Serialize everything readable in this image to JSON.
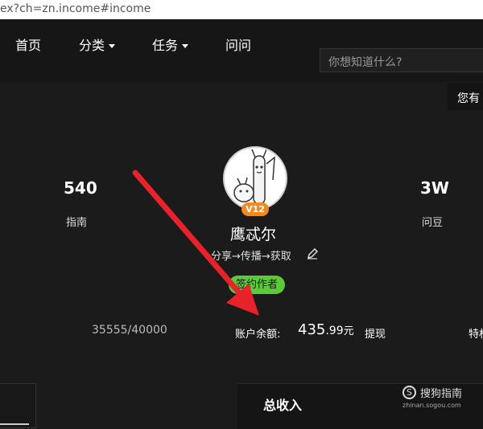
{
  "browser": {
    "url_fragment": "ex?ch=zn.income#income"
  },
  "nav": {
    "items": [
      {
        "label": "首页"
      },
      {
        "label": "分类"
      },
      {
        "label": "任务"
      },
      {
        "label": "问问"
      }
    ],
    "search_placeholder": "你想知道什么?",
    "notice_text": "您有"
  },
  "profile": {
    "stats_left": {
      "value": "540",
      "label": "指南"
    },
    "stats_right": {
      "value": "3W",
      "label": "问豆"
    },
    "level": "V12",
    "username": "鹰忒尔",
    "tagline": "分享→传播→获取",
    "author_badge": "签约作者",
    "progress": "35555/40000",
    "balance": {
      "label": "账户余额:",
      "integer": "435",
      "decimal": ".99",
      "unit": "元"
    },
    "withdraw_label": "提现",
    "right_truncated": "特权"
  },
  "bottom": {
    "total_income_label": "总收入"
  },
  "watermark": {
    "glyph": "S",
    "name": "搜狗指南",
    "url": "zhinan.sogou.com"
  },
  "colors": {
    "background": "#1b1b1b",
    "level_badge": "#f08a24",
    "author_badge": "#5cc93b",
    "annotation_arrow": "#e8222b"
  },
  "icons": [
    "caret-down-icon",
    "edit-pencil-icon",
    "sogou-logo-icon",
    "annotation-arrow"
  ]
}
